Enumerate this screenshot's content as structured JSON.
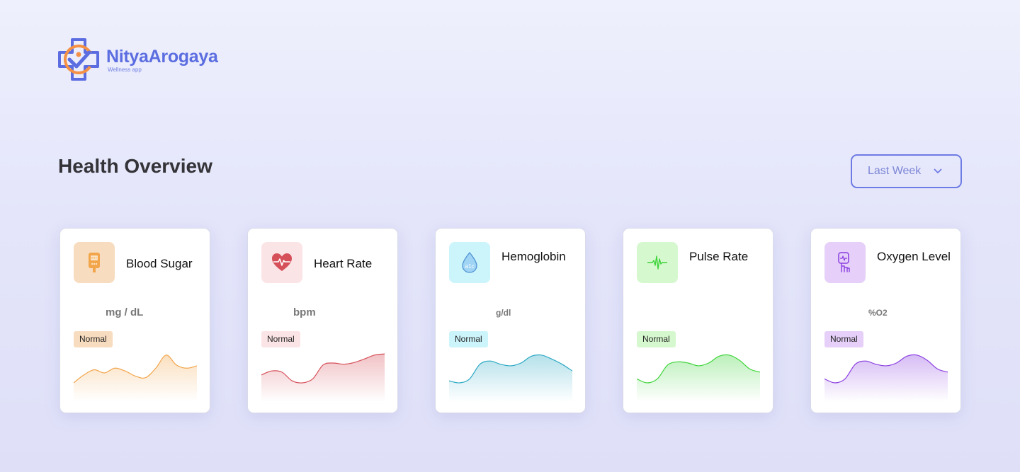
{
  "brand": {
    "name": "NityaArogaya",
    "tagline": "Wellness app"
  },
  "page_title": "Health Overview",
  "range_select": {
    "value": "Last Week"
  },
  "colors": {
    "accent": "#5b6de0",
    "blood_sugar": "#f2a54a",
    "heart_rate": "#d6505a",
    "hemoglobin": "#2aa8c4",
    "pulse_rate": "#3ed43a",
    "oxygen_level": "#8a3fe0"
  },
  "cards": [
    {
      "title": "Blood Sugar",
      "unit": "mg / dL",
      "status": "Normal",
      "icon": "glucose-meter-icon",
      "trend": [
        0.25,
        0.45,
        0.58,
        0.5,
        0.62,
        0.55,
        0.42,
        0.38,
        0.62,
        0.95,
        0.7,
        0.62,
        0.68
      ]
    },
    {
      "title": "Heart Rate",
      "unit": "bpm",
      "status": "Normal",
      "icon": "heart-pulse-icon",
      "trend": [
        0.45,
        0.55,
        0.52,
        0.3,
        0.25,
        0.35,
        0.7,
        0.75,
        0.72,
        0.76,
        0.85,
        0.95,
        0.98
      ]
    },
    {
      "title": "Hemoglobin",
      "unit": "g/dl",
      "status": "Normal",
      "icon": "blood-drop-a1c-icon",
      "trend": [
        0.3,
        0.25,
        0.35,
        0.72,
        0.8,
        0.72,
        0.68,
        0.75,
        0.92,
        0.95,
        0.85,
        0.72,
        0.55
      ]
    },
    {
      "title": "Pulse Rate",
      "unit": "",
      "status": "Normal",
      "icon": "pulse-wave-icon",
      "trend": [
        0.35,
        0.25,
        0.35,
        0.7,
        0.78,
        0.75,
        0.68,
        0.75,
        0.92,
        0.95,
        0.82,
        0.6,
        0.52
      ]
    },
    {
      "title": "Oxygen Level",
      "unit": "%O2",
      "status": "Normal",
      "icon": "pulse-oximeter-icon",
      "trend": [
        0.35,
        0.25,
        0.35,
        0.72,
        0.8,
        0.72,
        0.68,
        0.75,
        0.92,
        0.95,
        0.82,
        0.6,
        0.52
      ]
    }
  ]
}
